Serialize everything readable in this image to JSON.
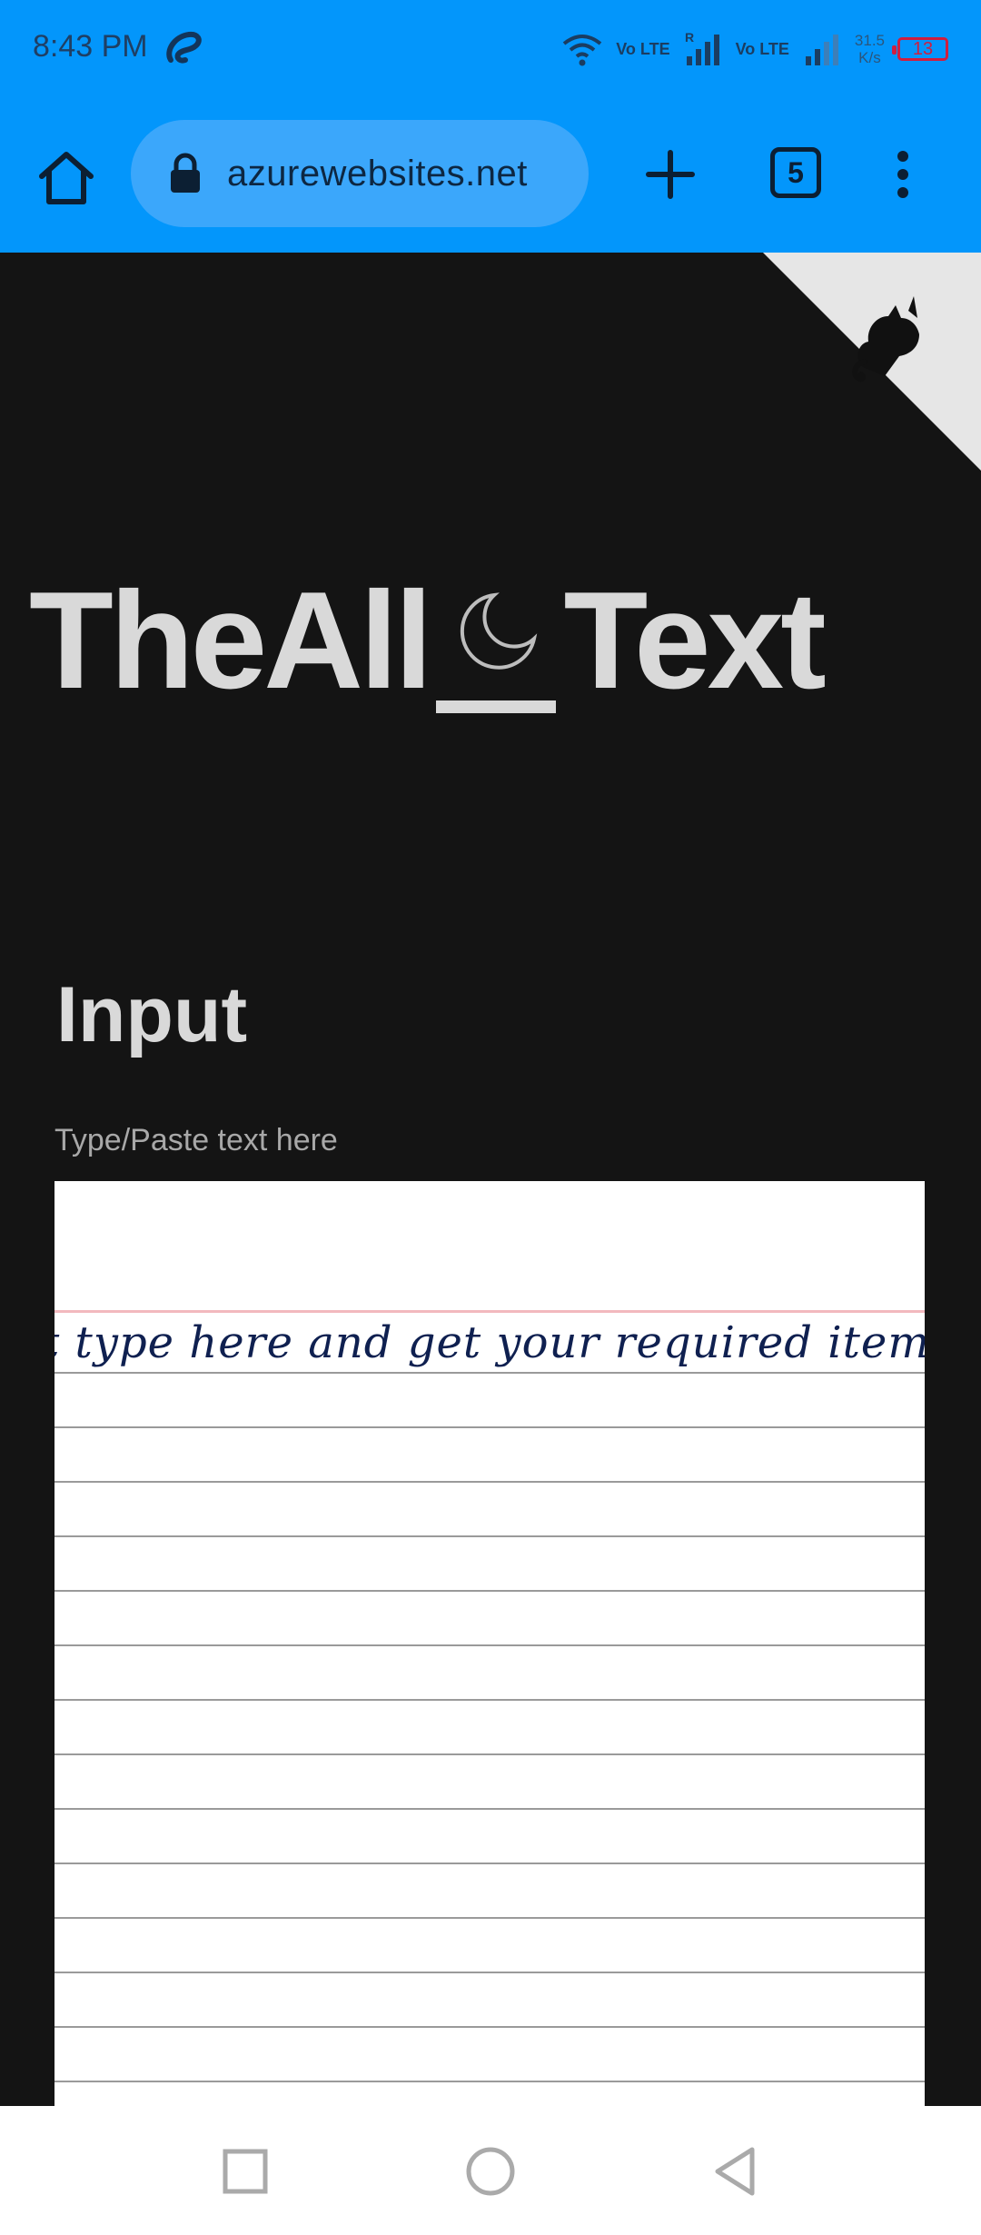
{
  "status_bar": {
    "time": "8:43 PM",
    "net_speed_value": "31.5",
    "net_speed_unit": "K/s",
    "battery": "13",
    "sim1": "Vo LTE",
    "sim2": "Vo LTE",
    "roaming": "R"
  },
  "browser": {
    "url": "azurewebsites.net",
    "tab_count": "5"
  },
  "page": {
    "title_left": "TheAll",
    "title_right": "Text",
    "section_heading": "Input",
    "input_hint": "Type/Paste text here",
    "input_text": "t type here and get your required item."
  },
  "icons": [
    "home-icon",
    "lock-icon",
    "plus-icon",
    "tabs-icon",
    "more-vert-icon",
    "github-cat-icon",
    "moon-icon",
    "square-icon",
    "circle-icon",
    "back-triangle-icon",
    "wifi-icon",
    "signal-icon",
    "battery-icon"
  ],
  "colors": {
    "chrome_blue": "#0396fb",
    "page_bg": "#141414",
    "title_text": "#d9d9d9",
    "ink": "#0f2050"
  }
}
